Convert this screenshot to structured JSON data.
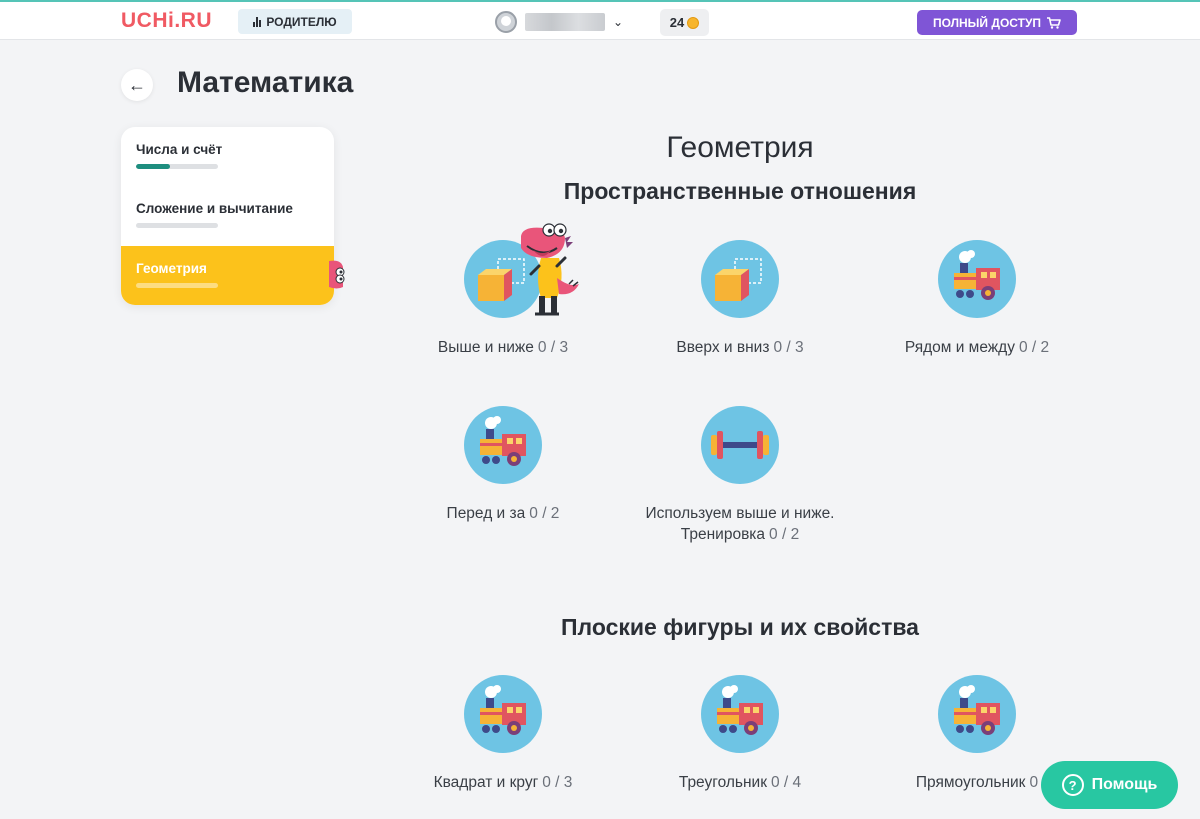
{
  "header": {
    "logo": "UCHi.RU",
    "parent_label": "РОДИТЕЛЮ",
    "full_access_label": "ПОЛНЫЙ ДОСТУП",
    "coins": "24"
  },
  "user": {
    "name": ""
  },
  "page": {
    "title": "Математика"
  },
  "sidebar": {
    "items": [
      {
        "label": "Числа и счёт",
        "progress": 0.42,
        "active": false
      },
      {
        "label": "Сложение и вычитание",
        "progress": 0,
        "active": false
      },
      {
        "label": "Геометрия",
        "progress": 0,
        "active": true
      }
    ]
  },
  "content": {
    "heading": "Геометрия",
    "sections": [
      {
        "title": "Пространственные отношения",
        "lessons": [
          {
            "label": "Выше и ниже",
            "count": "0 / 3",
            "icon": "cube-icon"
          },
          {
            "label": "Вверх и вниз",
            "count": "0 / 3",
            "icon": "cube-icon"
          },
          {
            "label": "Рядом и между",
            "count": "0 / 2",
            "icon": "train-icon"
          },
          {
            "label": "Перед и за",
            "count": "0 / 2",
            "icon": "train-icon"
          },
          {
            "label": "Используем выше и ниже. Тренировка",
            "count": "0 / 2",
            "icon": "dumbbell-icon"
          }
        ]
      },
      {
        "title": "Плоские фигуры и их свойства",
        "lessons": [
          {
            "label": "Квадрат и круг",
            "count": "0 / 3",
            "icon": "train-icon"
          },
          {
            "label": "Треугольник",
            "count": "0 / 4",
            "icon": "train-icon"
          },
          {
            "label": "Прямоугольник",
            "count": "0",
            "icon": "train-icon"
          }
        ]
      }
    ]
  },
  "help": {
    "label": "Помощь"
  },
  "colors": {
    "brand_red": "#f05a63",
    "accent_purple": "#7f55d6",
    "active_yellow": "#fcc21b",
    "progress_green": "#1e8e7f",
    "help_green": "#28c7a2",
    "lesson_circle": "#6ec4e4"
  }
}
